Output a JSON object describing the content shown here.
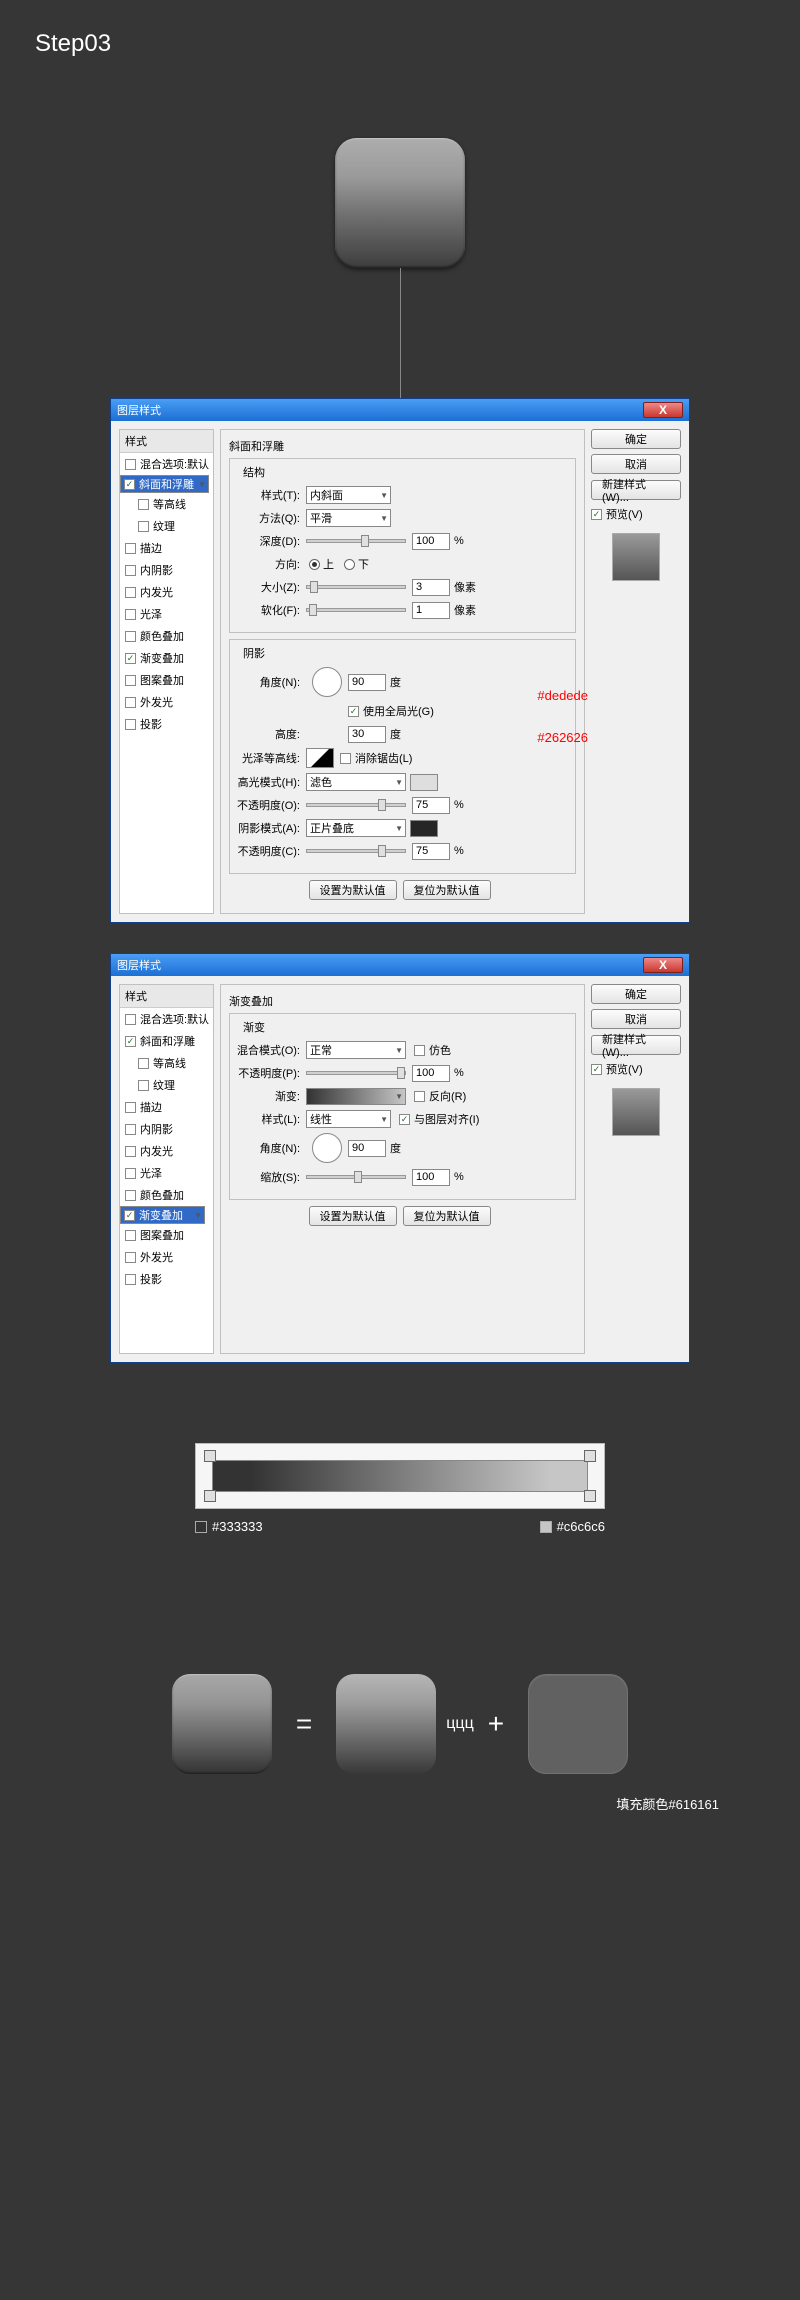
{
  "page": {
    "step_title": "Step03",
    "fill_note": "填充颜色#616161"
  },
  "dlg": {
    "title": "图层样式",
    "close": "X"
  },
  "styles": {
    "header": "样式",
    "items": [
      {
        "label": "混合选项:默认",
        "checked": false,
        "sel": false
      },
      {
        "label": "斜面和浮雕",
        "checked": true,
        "sel": true
      },
      {
        "label": "等高线",
        "checked": false,
        "sub": true
      },
      {
        "label": "纹理",
        "checked": false,
        "sub": true
      },
      {
        "label": "描边",
        "checked": false
      },
      {
        "label": "内阴影",
        "checked": false
      },
      {
        "label": "内发光",
        "checked": false
      },
      {
        "label": "光泽",
        "checked": false
      },
      {
        "label": "颜色叠加",
        "checked": false
      },
      {
        "label": "渐变叠加",
        "checked": true
      },
      {
        "label": "图案叠加",
        "checked": false
      },
      {
        "label": "外发光",
        "checked": false
      },
      {
        "label": "投影",
        "checked": false
      }
    ]
  },
  "bevel": {
    "title": "斜面和浮雕",
    "legend_struct": "结构",
    "legend_shadow": "阴影",
    "style_lbl": "样式(T):",
    "style_val": "内斜面",
    "method_lbl": "方法(Q):",
    "method_val": "平滑",
    "depth_lbl": "深度(D):",
    "depth_val": "100",
    "pct": "%",
    "dir_lbl": "方向:",
    "up": "上",
    "down": "下",
    "size_lbl": "大小(Z):",
    "size_val": "3",
    "px": "像素",
    "soften_lbl": "软化(F):",
    "soften_val": "1",
    "angle_lbl": "角度(N):",
    "angle_val": "90",
    "deg": "度",
    "global_lbl": "使用全局光(G)",
    "alt_lbl": "高度:",
    "alt_val": "30",
    "gloss_lbl": "光泽等高线:",
    "aa_lbl": "消除锯齿(L)",
    "hl_mode_lbl": "高光模式(H):",
    "hl_mode_val": "滤色",
    "hl_color": "#dedede",
    "hl_anno": "#dedede",
    "hl_op_lbl": "不透明度(O):",
    "hl_op_val": "75",
    "sh_mode_lbl": "阴影模式(A):",
    "sh_mode_val": "正片叠底",
    "sh_color": "#262626",
    "sh_anno": "#262626",
    "sh_op_lbl": "不透明度(C):",
    "sh_op_val": "75",
    "set_default": "设置为默认值",
    "reset_default": "复位为默认值"
  },
  "grad": {
    "title": "渐变叠加",
    "legend": "渐变",
    "blend_lbl": "混合模式(O):",
    "blend_val": "正常",
    "dither_lbl": "仿色",
    "op_lbl": "不透明度(P):",
    "op_val": "100",
    "grad_lbl": "渐变:",
    "reverse_lbl": "反向(R)",
    "style_lbl": "样式(L):",
    "style_val": "线性",
    "align_lbl": "与图层对齐(I)",
    "angle_lbl": "角度(N):",
    "angle_val": "90",
    "deg": "度",
    "scale_lbl": "缩放(S):",
    "scale_val": "100",
    "pct": "%",
    "set_default": "设置为默认值",
    "reset_default": "复位为默认值"
  },
  "styles2_sel": 9,
  "btns": {
    "ok": "确定",
    "cancel": "取消",
    "new": "新建样式(W)...",
    "preview": "预览(V)"
  },
  "gradient": {
    "c1": "#333333",
    "c2": "#c6c6c6"
  },
  "equation": {
    "eq": "=",
    "plus": "+"
  }
}
